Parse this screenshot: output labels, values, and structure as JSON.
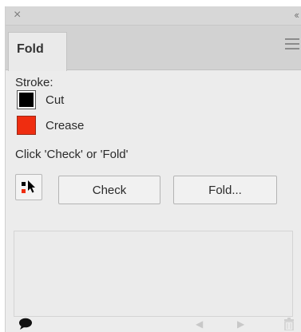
{
  "window": {
    "close_glyph": "×",
    "collapse_glyph": "‹‹"
  },
  "tab": {
    "label": "Fold"
  },
  "stroke": {
    "label": "Stroke:",
    "items": [
      {
        "label": "Cut",
        "color": "#000000"
      },
      {
        "label": "Crease",
        "color": "#ef2d10"
      }
    ]
  },
  "instruction": "Click 'Check' or 'Fold'",
  "buttons": {
    "check": "Check",
    "fold": "Fold..."
  },
  "icons": {
    "close": "close-icon",
    "collapse": "collapse-panel-icon",
    "menu": "panel-menu-icon",
    "tool": "select-tool-icon",
    "comment": "comment-icon",
    "prev": "previous-arrow-icon",
    "next": "next-arrow-icon",
    "trash": "trash-icon"
  },
  "colors": {
    "cut": "#000000",
    "crease": "#ef2d10"
  }
}
